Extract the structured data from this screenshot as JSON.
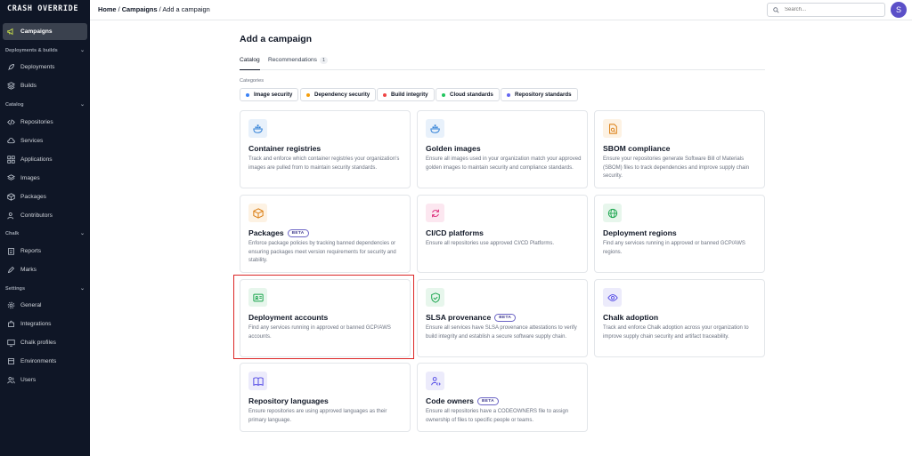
{
  "app": {
    "logo": "CRASH OVERRIDE"
  },
  "sidebar": {
    "items": [
      {
        "label": "Campaigns",
        "icon": "megaphone-icon",
        "active": true
      },
      {
        "label": "Deployments",
        "icon": "rocket-icon"
      },
      {
        "label": "Builds",
        "icon": "box-stack-icon"
      },
      {
        "label": "Repositories",
        "icon": "code-icon"
      },
      {
        "label": "Services",
        "icon": "cloud-icon"
      },
      {
        "label": "Applications",
        "icon": "grid-icon"
      },
      {
        "label": "Images",
        "icon": "layers-icon"
      },
      {
        "label": "Packages",
        "icon": "package-icon"
      },
      {
        "label": "Contributors",
        "icon": "users-icon"
      },
      {
        "label": "Reports",
        "icon": "clipboard-icon"
      },
      {
        "label": "Marks",
        "icon": "pen-icon"
      },
      {
        "label": "General",
        "icon": "gear-icon"
      },
      {
        "label": "Integrations",
        "icon": "puzzle-icon"
      },
      {
        "label": "Chalk profiles",
        "icon": "monitor-icon"
      },
      {
        "label": "Environments",
        "icon": "environment-icon"
      },
      {
        "label": "Users",
        "icon": "user-group-icon"
      }
    ],
    "sections": [
      {
        "label": "Deployments & builds"
      },
      {
        "label": "Catalog"
      },
      {
        "label": "Chalk"
      },
      {
        "label": "Settings"
      }
    ]
  },
  "header": {
    "breadcrumb": {
      "home": "Home",
      "sep1": " / ",
      "campaigns": "Campaigns",
      "sep2": " / ",
      "current": "Add a campaign"
    },
    "search_placeholder": "Search...",
    "avatar_initial": "S"
  },
  "main": {
    "title": "Add a campaign",
    "tabs": [
      {
        "label": "Catalog",
        "active": true
      },
      {
        "label": "Recommendations",
        "count": "1"
      }
    ],
    "categories_label": "Categories",
    "categories": [
      {
        "label": "Image security",
        "color": "#3b82f6"
      },
      {
        "label": "Dependency security",
        "color": "#f59e0b"
      },
      {
        "label": "Build integrity",
        "color": "#ef4444"
      },
      {
        "label": "Cloud standards",
        "color": "#22c55e"
      },
      {
        "label": "Repository standards",
        "color": "#6366f1"
      }
    ],
    "beta_label": "BETA",
    "cards": [
      {
        "title": "Container registries",
        "desc": "Track and enforce which container registries your organization's images are pulled from to maintain security standards.",
        "icon": "docker-icon",
        "color": "#2f7fd6",
        "bg": "#e8f1fb"
      },
      {
        "title": "Golden images",
        "desc": "Ensure all images used in your organization match your approved golden images to maintain security and compliance standards.",
        "icon": "docker-icon",
        "color": "#2f7fd6",
        "bg": "#e8f1fb"
      },
      {
        "title": "SBOM compliance",
        "desc": "Ensure your repositories generate Software Bill of Materials (SBOM) files to track dependencies and improve supply chain security.",
        "icon": "file-search-icon",
        "color": "#d97706",
        "bg": "#fdf2e3"
      },
      {
        "title": "Packages",
        "desc": "Enforce package policies by tracking banned dependencies or ensuring packages meet version requirements for security and stability.",
        "icon": "package-icon",
        "color": "#d97706",
        "bg": "#fdf2e3",
        "beta": true
      },
      {
        "title": "CI/CD platforms",
        "desc": "Ensure all repositories use approved CI/CD Platforms.",
        "icon": "refresh-icon",
        "color": "#db2777",
        "bg": "#fce7f0"
      },
      {
        "title": "Deployment regions",
        "desc": "Find any services running in approved or banned GCP/AWS regions.",
        "icon": "globe-icon",
        "color": "#16a34a",
        "bg": "#e7f6ec"
      },
      {
        "title": "Deployment accounts",
        "desc": "Find any services running in approved or banned GCP/AWS accounts.",
        "icon": "id-card-icon",
        "color": "#16a34a",
        "bg": "#e7f6ec"
      },
      {
        "title": "SLSA provenance",
        "desc": "Ensure all services have SLSA provenance attestations to verify build integrity and establish a secure software supply chain.",
        "icon": "shield-check-icon",
        "color": "#16a34a",
        "bg": "#e7f6ec",
        "beta": true
      },
      {
        "title": "Chalk adoption",
        "desc": "Track and enforce Chalk adoption across your organization to improve supply chain security and artifact traceability.",
        "icon": "eye-icon",
        "color": "#4f46e5",
        "bg": "#ecebfb"
      },
      {
        "title": "Repository languages",
        "desc": "Ensure repositories are using approved languages as their primary language.",
        "icon": "book-icon",
        "color": "#4f46e5",
        "bg": "#ecebfb"
      },
      {
        "title": "Code owners",
        "desc": "Ensure all repositories have a CODEOWNERS file to assign ownership of files to specific people or teams.",
        "icon": "user-code-icon",
        "color": "#4f46e5",
        "bg": "#ecebfb",
        "beta": true
      }
    ]
  }
}
